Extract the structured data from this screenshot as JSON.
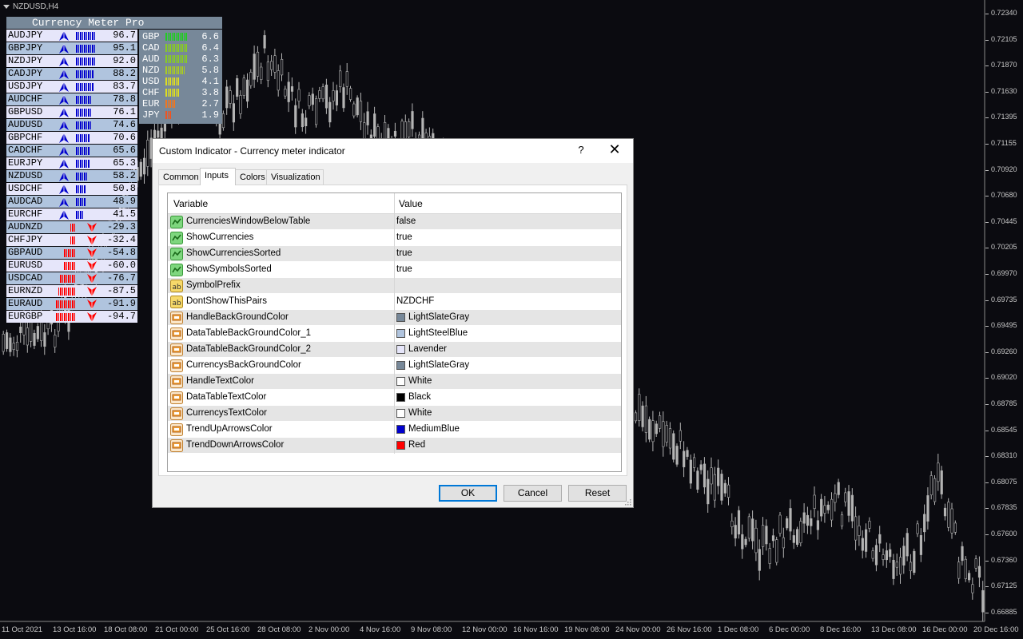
{
  "chart": {
    "title": "NZDUSD,H4",
    "price_labels": [
      "0.72340",
      "0.72105",
      "0.71870",
      "0.71630",
      "0.71395",
      "0.71155",
      "0.70920",
      "0.70680",
      "0.70445",
      "0.70205",
      "0.69970",
      "0.69735",
      "0.69495",
      "0.69260",
      "0.69020",
      "0.68785",
      "0.68545",
      "0.68310",
      "0.68075",
      "0.67835",
      "0.67600",
      "0.67360",
      "0.67125",
      "0.66885"
    ],
    "time_labels": [
      "11 Oct 2021",
      "13 Oct 16:00",
      "18 Oct 08:00",
      "21 Oct 00:00",
      "25 Oct 16:00",
      "28 Oct 08:00",
      "2 Nov 00:00",
      "4 Nov 16:00",
      "9 Nov 08:00",
      "12 Nov 00:00",
      "16 Nov 16:00",
      "19 Nov 08:00",
      "24 Nov 00:00",
      "26 Nov 16:00",
      "1 Dec 08:00",
      "6 Dec 00:00",
      "8 Dec 16:00",
      "13 Dec 08:00",
      "16 Dec 00:00",
      "20 Dec 16:00"
    ],
    "candle_color": "#b4b4b4"
  },
  "meter": {
    "title": "Currency Meter Pro",
    "colors": {
      "header": "#778899",
      "row_a": "#b0c4de",
      "row_b": "#e6e6fa",
      "up_arrow": "#0000cd",
      "down_arrow": "#ff0000"
    },
    "pairs": [
      {
        "symbol": "AUDJPY",
        "value": "96.7",
        "trend": "up",
        "bars": 10
      },
      {
        "symbol": "GBPJPY",
        "value": "95.1",
        "trend": "up",
        "bars": 10
      },
      {
        "symbol": "NZDJPY",
        "value": "92.0",
        "trend": "up",
        "bars": 10
      },
      {
        "symbol": "CADJPY",
        "value": "88.2",
        "trend": "up",
        "bars": 9
      },
      {
        "symbol": "USDJPY",
        "value": "83.7",
        "trend": "up",
        "bars": 9
      },
      {
        "symbol": "AUDCHF",
        "value": "78.8",
        "trend": "up",
        "bars": 8
      },
      {
        "symbol": "GBPUSD",
        "value": "76.1",
        "trend": "up",
        "bars": 8
      },
      {
        "symbol": "AUDUSD",
        "value": "74.6",
        "trend": "up",
        "bars": 8
      },
      {
        "symbol": "GBPCHF",
        "value": "70.6",
        "trend": "up",
        "bars": 7
      },
      {
        "symbol": "CADCHF",
        "value": "65.6",
        "trend": "up",
        "bars": 7
      },
      {
        "symbol": "EURJPY",
        "value": "65.3",
        "trend": "up",
        "bars": 7
      },
      {
        "symbol": "NZDUSD",
        "value": "58.2",
        "trend": "up",
        "bars": 6
      },
      {
        "symbol": "USDCHF",
        "value": "50.8",
        "trend": "up",
        "bars": 5
      },
      {
        "symbol": "AUDCAD",
        "value": "48.9",
        "trend": "up",
        "bars": 5
      },
      {
        "symbol": "EURCHF",
        "value": "41.5",
        "trend": "up",
        "bars": 4
      },
      {
        "symbol": "AUDNZD",
        "value": "-29.3",
        "trend": "down",
        "bars": 3
      },
      {
        "symbol": "CHFJPY",
        "value": "-32.4",
        "trend": "down",
        "bars": 3
      },
      {
        "symbol": "GBPAUD",
        "value": "-54.8",
        "trend": "down",
        "bars": 6
      },
      {
        "symbol": "EURUSD",
        "value": "-60.0",
        "trend": "down",
        "bars": 6
      },
      {
        "symbol": "USDCAD",
        "value": "-76.7",
        "trend": "down",
        "bars": 8
      },
      {
        "symbol": "EURNZD",
        "value": "-87.5",
        "trend": "down",
        "bars": 9
      },
      {
        "symbol": "EURAUD",
        "value": "-91.9",
        "trend": "down",
        "bars": 10
      },
      {
        "symbol": "EURGBP",
        "value": "-94.7",
        "trend": "down",
        "bars": 10
      }
    ],
    "currencies": [
      {
        "symbol": "GBP",
        "value": "6.6",
        "bars": 11,
        "color": "#22cc22"
      },
      {
        "symbol": "CAD",
        "value": "6.4",
        "bars": 11,
        "color": "#88cc22"
      },
      {
        "symbol": "AUD",
        "value": "6.3",
        "bars": 11,
        "color": "#88cc22"
      },
      {
        "symbol": "NZD",
        "value": "5.8",
        "bars": 10,
        "color": "#aacc22"
      },
      {
        "symbol": "USD",
        "value": "4.1",
        "bars": 7,
        "color": "#dddd22"
      },
      {
        "symbol": "CHF",
        "value": "3.8",
        "bars": 7,
        "color": "#dddd22"
      },
      {
        "symbol": "EUR",
        "value": "2.7",
        "bars": 5,
        "color": "#ee7722"
      },
      {
        "symbol": "JPY",
        "value": "1.9",
        "bars": 3,
        "color": "#ee5522"
      }
    ]
  },
  "dialog": {
    "title": "Custom Indicator - Currency meter indicator",
    "help": "?",
    "close": "✕",
    "tabs": [
      "Common",
      "Inputs",
      "Colors",
      "Visualization"
    ],
    "active_tab": "Inputs",
    "columns": {
      "variable": "Variable",
      "value": "Value"
    },
    "rows": [
      {
        "icon": "bool-icon",
        "name": "CurrenciesWindowBelowTable",
        "value": "false"
      },
      {
        "icon": "bool-icon",
        "name": "ShowCurrencies",
        "value": "true"
      },
      {
        "icon": "bool-icon",
        "name": "ShowCurrenciesSorted",
        "value": "true"
      },
      {
        "icon": "bool-icon",
        "name": "ShowSymbolsSorted",
        "value": "true"
      },
      {
        "icon": "string-icon",
        "name": "SymbolPrefix",
        "value": ""
      },
      {
        "icon": "string-icon",
        "name": "DontShowThisPairs",
        "value": "NZDCHF"
      },
      {
        "icon": "color-icon",
        "name": "HandleBackGroundColor",
        "value": "LightSlateGray",
        "swatch": "#778899"
      },
      {
        "icon": "color-icon",
        "name": "DataTableBackGroundColor_1",
        "value": "LightSteelBlue",
        "swatch": "#b0c4de"
      },
      {
        "icon": "color-icon",
        "name": "DataTableBackGroundColor_2",
        "value": "Lavender",
        "swatch": "#e6e6fa"
      },
      {
        "icon": "color-icon",
        "name": "CurrencysBackGroundColor",
        "value": "LightSlateGray",
        "swatch": "#778899"
      },
      {
        "icon": "color-icon",
        "name": "HandleTextColor",
        "value": "White",
        "swatch": "#ffffff"
      },
      {
        "icon": "color-icon",
        "name": "DataTableTextColor",
        "value": "Black",
        "swatch": "#000000"
      },
      {
        "icon": "color-icon",
        "name": "CurrencysTextColor",
        "value": "White",
        "swatch": "#ffffff"
      },
      {
        "icon": "color-icon",
        "name": "TrendUpArrowsColor",
        "value": "MediumBlue",
        "swatch": "#0000cd"
      },
      {
        "icon": "color-icon",
        "name": "TrendDownArrowsColor",
        "value": "Red",
        "swatch": "#ff0000"
      }
    ],
    "buttons": {
      "ok": "OK",
      "cancel": "Cancel",
      "reset": "Reset"
    }
  }
}
